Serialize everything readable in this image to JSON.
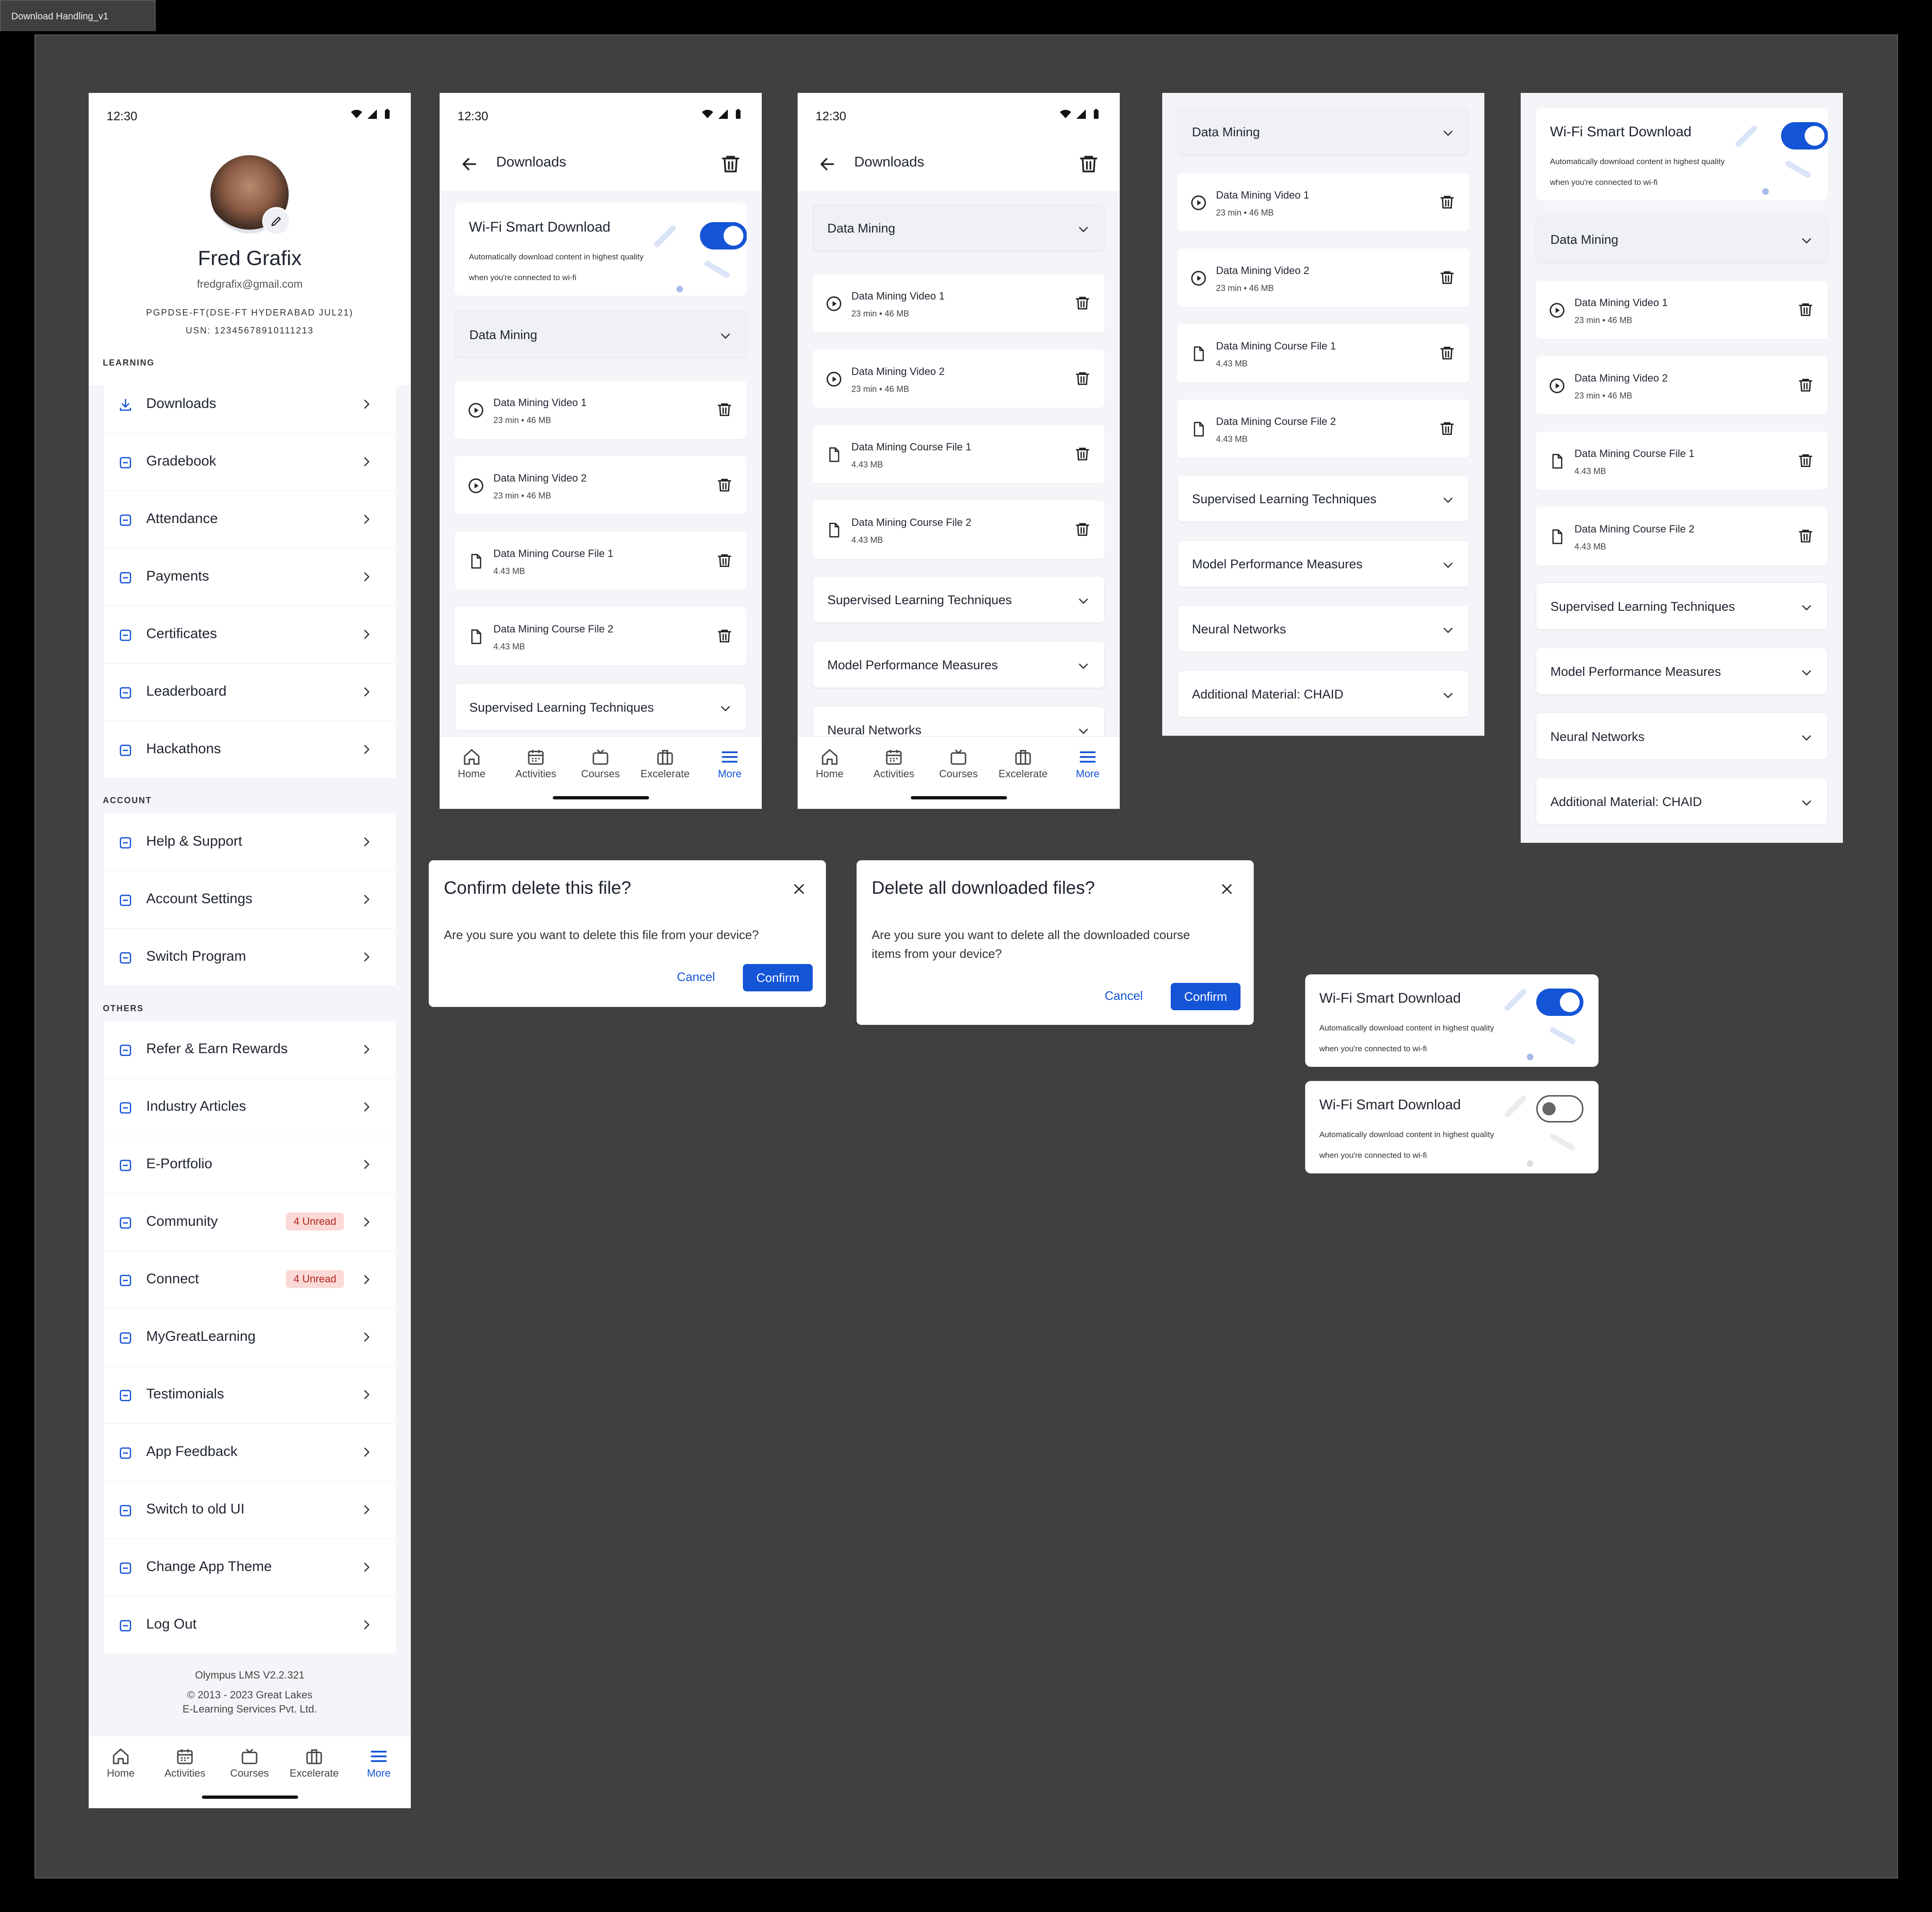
{
  "frame_label": "Download Handling_v1",
  "status_time": "12:30",
  "profile": {
    "name": "Fred Grafix",
    "email": "fredgrafix@gmail.com",
    "program": "PGPDSE-FT(DSE-FT HYDERABAD JUL21)",
    "usn": "USN: 12345678910111213"
  },
  "menu": {
    "learning_title": "LEARNING",
    "learning": [
      {
        "label": "Downloads",
        "icon": "download-icon"
      },
      {
        "label": "Gradebook",
        "icon": "chart-line-icon"
      },
      {
        "label": "Attendance",
        "icon": "calendar-check-icon"
      },
      {
        "label": "Payments",
        "icon": "money-icon"
      },
      {
        "label": "Certificates",
        "icon": "certificate-icon"
      },
      {
        "label": "Leaderboard",
        "icon": "trophy-icon"
      },
      {
        "label": "Hackathons",
        "icon": "code-icon"
      }
    ],
    "account_title": "ACCOUNT",
    "account": [
      {
        "label": "Help & Support",
        "icon": "help-icon"
      },
      {
        "label": "Account Settings",
        "icon": "gear-icon"
      },
      {
        "label": "Switch Program",
        "icon": "refresh-icon"
      }
    ],
    "others_title": "OTHERS",
    "others": [
      {
        "label": "Refer & Earn Rewards",
        "icon": "dollar-icon"
      },
      {
        "label": "Industry Articles",
        "icon": "newspaper-icon"
      },
      {
        "label": "E-Portfolio",
        "icon": "folder-icon"
      },
      {
        "label": "Community",
        "icon": "users-icon",
        "badge": "4 Unread"
      },
      {
        "label": "Connect",
        "icon": "heart-handshake-icon",
        "badge": "4 Unread"
      },
      {
        "label": "MyGreatLearning",
        "icon": "hashtag-icon"
      },
      {
        "label": "Testimonials",
        "icon": "thumbs-up-icon"
      },
      {
        "label": "App Feedback",
        "icon": "phone-icon"
      },
      {
        "label": "Switch to old UI",
        "icon": "refresh-icon"
      },
      {
        "label": "Change App Theme",
        "icon": "brush-icon"
      },
      {
        "label": "Log Out",
        "icon": "logout-icon"
      }
    ]
  },
  "footer": {
    "version": "Olympus LMS V2.2.321",
    "copyright_1": "© 2013 - 2023 Great Lakes",
    "copyright_2": "E-Learning Services Pvt. Ltd."
  },
  "nav": [
    "Home",
    "Activities",
    "Courses",
    "Excelerate",
    "More"
  ],
  "downloads": {
    "title": "Downloads",
    "wifi_title": "Wi-Fi Smart Download",
    "wifi_desc_1": "Automatically download content in highest quality",
    "wifi_desc_2": "when you're connected to wi-fi",
    "wifi_on": true,
    "section": "Data Mining",
    "items": [
      {
        "name": "Data Mining Video 1",
        "meta": "23 min • 46 MB",
        "icon": "play-circle-icon"
      },
      {
        "name": "Data Mining Video 2",
        "meta": "23 min • 46 MB",
        "icon": "play-circle-icon"
      },
      {
        "name": "Data Mining Course File 1",
        "meta": "4.43 MB",
        "icon": "file-icon"
      },
      {
        "name": "Data Mining Course File 2",
        "meta": "4.43 MB",
        "icon": "file-icon"
      }
    ],
    "other_sections": [
      "Supervised Learning Techniques",
      "Model Performance Measures",
      "Neural Networks",
      "Additional Material: CHAID"
    ]
  },
  "dialogs": {
    "delete_file": {
      "title": "Confirm delete this file?",
      "body": "Are you sure you want to delete this file from your device?",
      "cancel": "Cancel",
      "confirm": "Confirm"
    },
    "delete_all": {
      "title": "Delete all downloaded files?",
      "body_1": "Are you sure you want to delete all the downloaded course",
      "body_2": "items from your device?",
      "cancel": "Cancel",
      "confirm": "Confirm"
    }
  },
  "colors": {
    "accent": "#1454d6",
    "badge_bg": "#fbd9d6",
    "badge_text": "#b3261e",
    "canvas": "#404040"
  }
}
